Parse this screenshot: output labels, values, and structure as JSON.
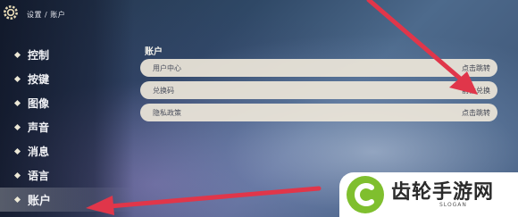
{
  "breadcrumb": "设置 / 账户",
  "sidebar": {
    "items": [
      {
        "label": "控制"
      },
      {
        "label": "按键"
      },
      {
        "label": "图像"
      },
      {
        "label": "声音"
      },
      {
        "label": "消息"
      },
      {
        "label": "语言"
      },
      {
        "label": "账户",
        "active": true
      }
    ]
  },
  "section": {
    "title": "账户"
  },
  "rows": [
    {
      "label": "用户中心",
      "action": "点击跳转"
    },
    {
      "label": "兑换码",
      "action": "前往兑换"
    },
    {
      "label": "隐私政策",
      "action": "点击跳转"
    }
  ],
  "watermark": {
    "brand": "齿轮手游网",
    "slogan": "SLOGAN"
  },
  "colors": {
    "arrow": "#e0364a",
    "logo_green": "#7fbf2e",
    "row_bg": "#ece5d8"
  }
}
